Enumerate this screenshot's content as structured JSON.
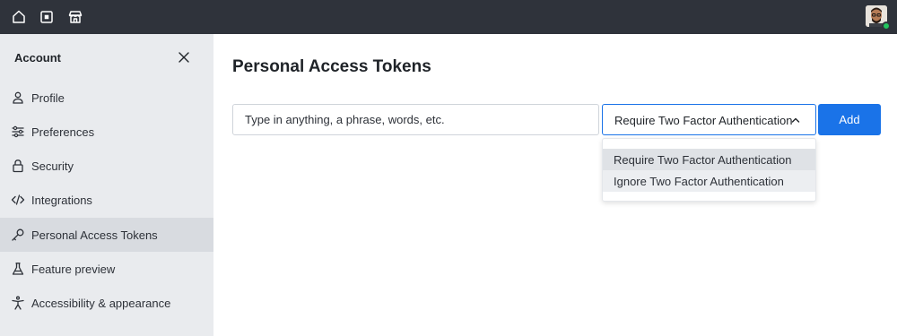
{
  "topbar": {
    "icons": [
      "home-icon",
      "chip-icon",
      "store-icon"
    ],
    "avatar": "user-avatar",
    "status_color": "#22c55e"
  },
  "sidebar": {
    "title": "Account",
    "items": [
      {
        "label": "Profile",
        "icon": "person-icon",
        "active": false
      },
      {
        "label": "Preferences",
        "icon": "sliders-icon",
        "active": false
      },
      {
        "label": "Security",
        "icon": "lock-icon",
        "active": false
      },
      {
        "label": "Integrations",
        "icon": "code-icon",
        "active": false
      },
      {
        "label": "Personal Access Tokens",
        "icon": "key-icon",
        "active": true
      },
      {
        "label": "Feature preview",
        "icon": "flask-icon",
        "active": false
      },
      {
        "label": "Accessibility & appearance",
        "icon": "accessibility-icon",
        "active": false
      }
    ]
  },
  "main": {
    "title": "Personal Access Tokens",
    "input": {
      "value": "",
      "placeholder": "Type in anything, a phrase, words, etc."
    },
    "select": {
      "value": "Require Two Factor Authentication",
      "options": [
        "Require Two Factor Authentication",
        "Ignore Two Factor Authentication"
      ]
    },
    "add_label": "Add"
  },
  "colors": {
    "topbar": "#2f333b",
    "sidebar": "#e9ebee",
    "sidebar_active": "#d8dbe0",
    "accent": "#1a73e8"
  }
}
